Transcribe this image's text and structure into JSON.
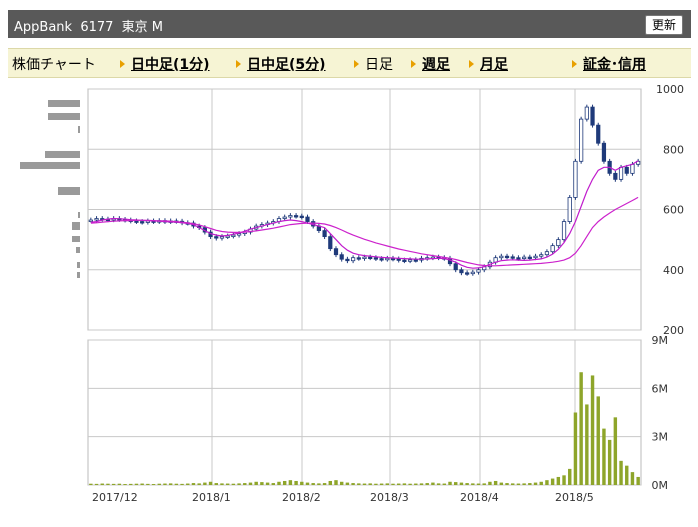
{
  "header": {
    "title": "AppBank  6177  東京 M",
    "refresh_label": "更新"
  },
  "tabs": [
    {
      "label": "株価チャート",
      "link": false,
      "arrow": false
    },
    {
      "label": "日中足(1分)",
      "link": true,
      "arrow": true
    },
    {
      "label": "日中足(5分)",
      "link": true,
      "arrow": true
    },
    {
      "label": "日足",
      "link": false,
      "arrow": true
    },
    {
      "label": "週足",
      "link": true,
      "arrow": true
    },
    {
      "label": "月足",
      "link": true,
      "arrow": true
    },
    {
      "label": "証金･信用",
      "link": true,
      "arrow": true
    }
  ],
  "chart_data": [
    {
      "type": "candlestick",
      "y_ticks": [
        "1000",
        "800",
        "600",
        "400",
        "200"
      ],
      "ylim": [
        200,
        1000
      ],
      "x_labels": [
        "2017/12",
        "2018/1",
        "2018/2",
        "2018/3",
        "2018/4",
        "2018/5"
      ],
      "series": [
        {
          "name": "",
          "values": [
            565,
            570,
            568,
            566,
            570,
            567,
            565,
            562,
            560,
            558,
            562,
            560,
            563,
            560,
            562,
            561,
            556,
            555,
            545,
            540,
            525,
            510,
            505,
            510,
            512,
            515,
            520,
            525,
            535,
            545,
            550,
            555,
            560,
            570,
            575,
            580,
            578,
            575,
            560,
            545,
            530,
            510,
            470,
            450,
            435,
            430,
            440,
            438,
            442,
            440,
            437,
            435,
            438,
            436,
            432,
            430,
            433,
            432,
            438,
            440,
            442,
            440,
            438,
            420,
            400,
            390,
            388,
            392,
            400,
            410,
            425,
            440,
            445,
            443,
            440,
            438,
            442,
            440,
            445,
            450,
            460,
            480,
            500,
            560,
            640,
            760,
            900,
            940,
            880,
            820,
            760,
            720,
            700,
            740,
            720,
            750,
            760
          ]
        },
        {
          "name": "",
          "values": [
            558,
            560,
            565,
            568,
            570,
            569,
            568,
            566,
            565,
            564,
            563,
            562,
            561,
            560,
            559,
            558,
            556,
            554,
            550,
            540,
            530,
            520,
            515,
            512,
            514,
            518,
            522,
            528,
            535,
            540,
            545,
            550,
            555,
            560,
            563,
            565,
            563,
            560,
            555,
            550,
            545,
            540,
            520,
            500,
            480,
            465,
            455,
            450,
            447,
            445,
            443,
            441,
            440,
            439,
            438,
            437,
            436,
            435,
            435,
            436,
            437,
            438,
            437,
            432,
            425,
            415,
            408,
            405,
            406,
            410,
            418,
            425,
            430,
            432,
            433,
            432,
            431,
            432,
            434,
            436,
            442,
            452,
            468,
            490,
            520,
            560,
            610,
            660,
            700,
            730,
            740,
            740,
            730,
            740,
            745,
            750,
            762
          ]
        },
        {
          "name": "",
          "values": [
            555,
            556,
            558,
            560,
            561,
            562,
            563,
            563,
            564,
            564,
            564,
            563,
            562,
            562,
            561,
            560,
            558,
            556,
            553,
            549,
            543,
            537,
            531,
            527,
            525,
            524,
            524,
            525,
            527,
            529,
            532,
            535,
            538,
            542,
            546,
            550,
            552,
            554,
            555,
            555,
            554,
            552,
            547,
            540,
            532,
            523,
            515,
            508,
            501,
            495,
            489,
            484,
            479,
            474,
            469,
            465,
            461,
            457,
            453,
            450,
            447,
            444,
            441,
            438,
            434,
            429,
            424,
            420,
            416,
            414,
            413,
            413,
            414,
            415,
            416,
            417,
            418,
            419,
            420,
            421,
            423,
            425,
            428,
            432,
            440,
            455,
            480,
            510,
            540,
            560,
            575,
            588,
            600,
            610,
            620,
            630,
            640
          ]
        }
      ]
    },
    {
      "type": "bar",
      "y_ticks": [
        "9M",
        "6M",
        "3M",
        "0M"
      ],
      "ylim": [
        0,
        9
      ],
      "values": [
        0.08,
        0.07,
        0.09,
        0.08,
        0.07,
        0.08,
        0.06,
        0.07,
        0.08,
        0.09,
        0.07,
        0.06,
        0.08,
        0.09,
        0.1,
        0.08,
        0.07,
        0.09,
        0.12,
        0.1,
        0.15,
        0.2,
        0.12,
        0.1,
        0.09,
        0.08,
        0.1,
        0.12,
        0.15,
        0.2,
        0.18,
        0.15,
        0.12,
        0.2,
        0.25,
        0.3,
        0.25,
        0.2,
        0.15,
        0.12,
        0.1,
        0.12,
        0.25,
        0.3,
        0.2,
        0.15,
        0.12,
        0.1,
        0.09,
        0.1,
        0.08,
        0.09,
        0.1,
        0.08,
        0.09,
        0.1,
        0.08,
        0.09,
        0.1,
        0.12,
        0.15,
        0.1,
        0.09,
        0.2,
        0.18,
        0.15,
        0.12,
        0.1,
        0.09,
        0.1,
        0.2,
        0.25,
        0.15,
        0.12,
        0.1,
        0.09,
        0.1,
        0.12,
        0.15,
        0.2,
        0.3,
        0.4,
        0.5,
        0.6,
        1.0,
        4.5,
        7.0,
        5.0,
        6.8,
        5.5,
        3.5,
        2.8,
        4.2,
        1.5,
        1.2,
        0.8,
        0.5
      ]
    }
  ],
  "colors": {
    "candle_up": "#ffffff",
    "candle_down": "#1f3a7a",
    "ma_short": "#7a1040",
    "ma_mid": "#c01ccc",
    "ma_long": "#cc22cc",
    "volume": "#8ea52a",
    "grid": "#c8c8c8"
  }
}
